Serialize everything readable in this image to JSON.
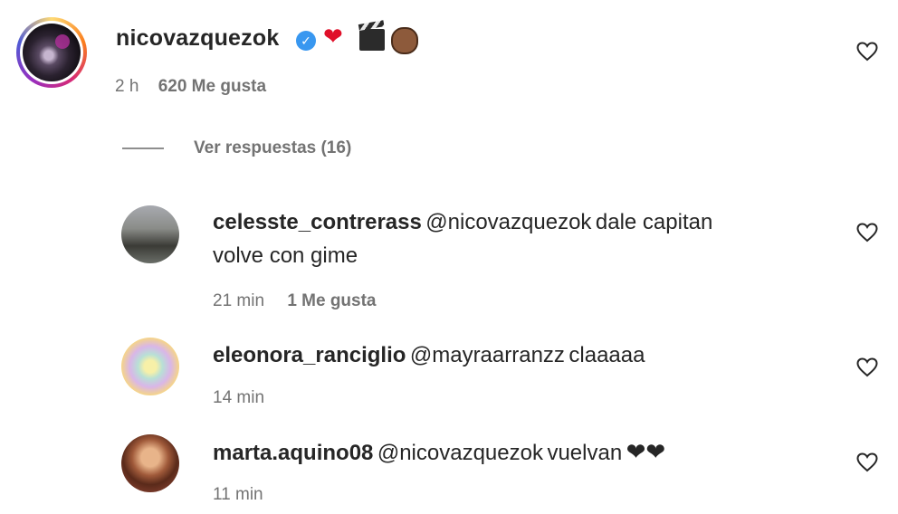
{
  "main_comment": {
    "username": "nicovazquezok",
    "time": "2 h",
    "likes": "620 Me gusta",
    "emoji_heart": "❤"
  },
  "replies_toggle": "Ver respuestas (16)",
  "replies": [
    {
      "username": "celesste_contrerass",
      "mention": "@nicovazquezok",
      "text_line1": "dale capitan",
      "text_line2": "volve con gime",
      "time": "21 min",
      "likes": "1 Me gusta"
    },
    {
      "username": "eleonora_ranciglio",
      "mention": "@mayraarranzz",
      "text": "claaaaa",
      "time": "14 min"
    },
    {
      "username": "marta.aquino08",
      "mention": "@nicovazquezok",
      "text": "vuelvan",
      "hearts": "❤❤",
      "time": "11 min"
    }
  ],
  "icons": {
    "verified": "✓",
    "like": "heart-outline-icon"
  },
  "colors": {
    "mention": "#5f62c9",
    "muted": "#737373",
    "verified": "#3897f0",
    "heart": "#e0102a"
  }
}
